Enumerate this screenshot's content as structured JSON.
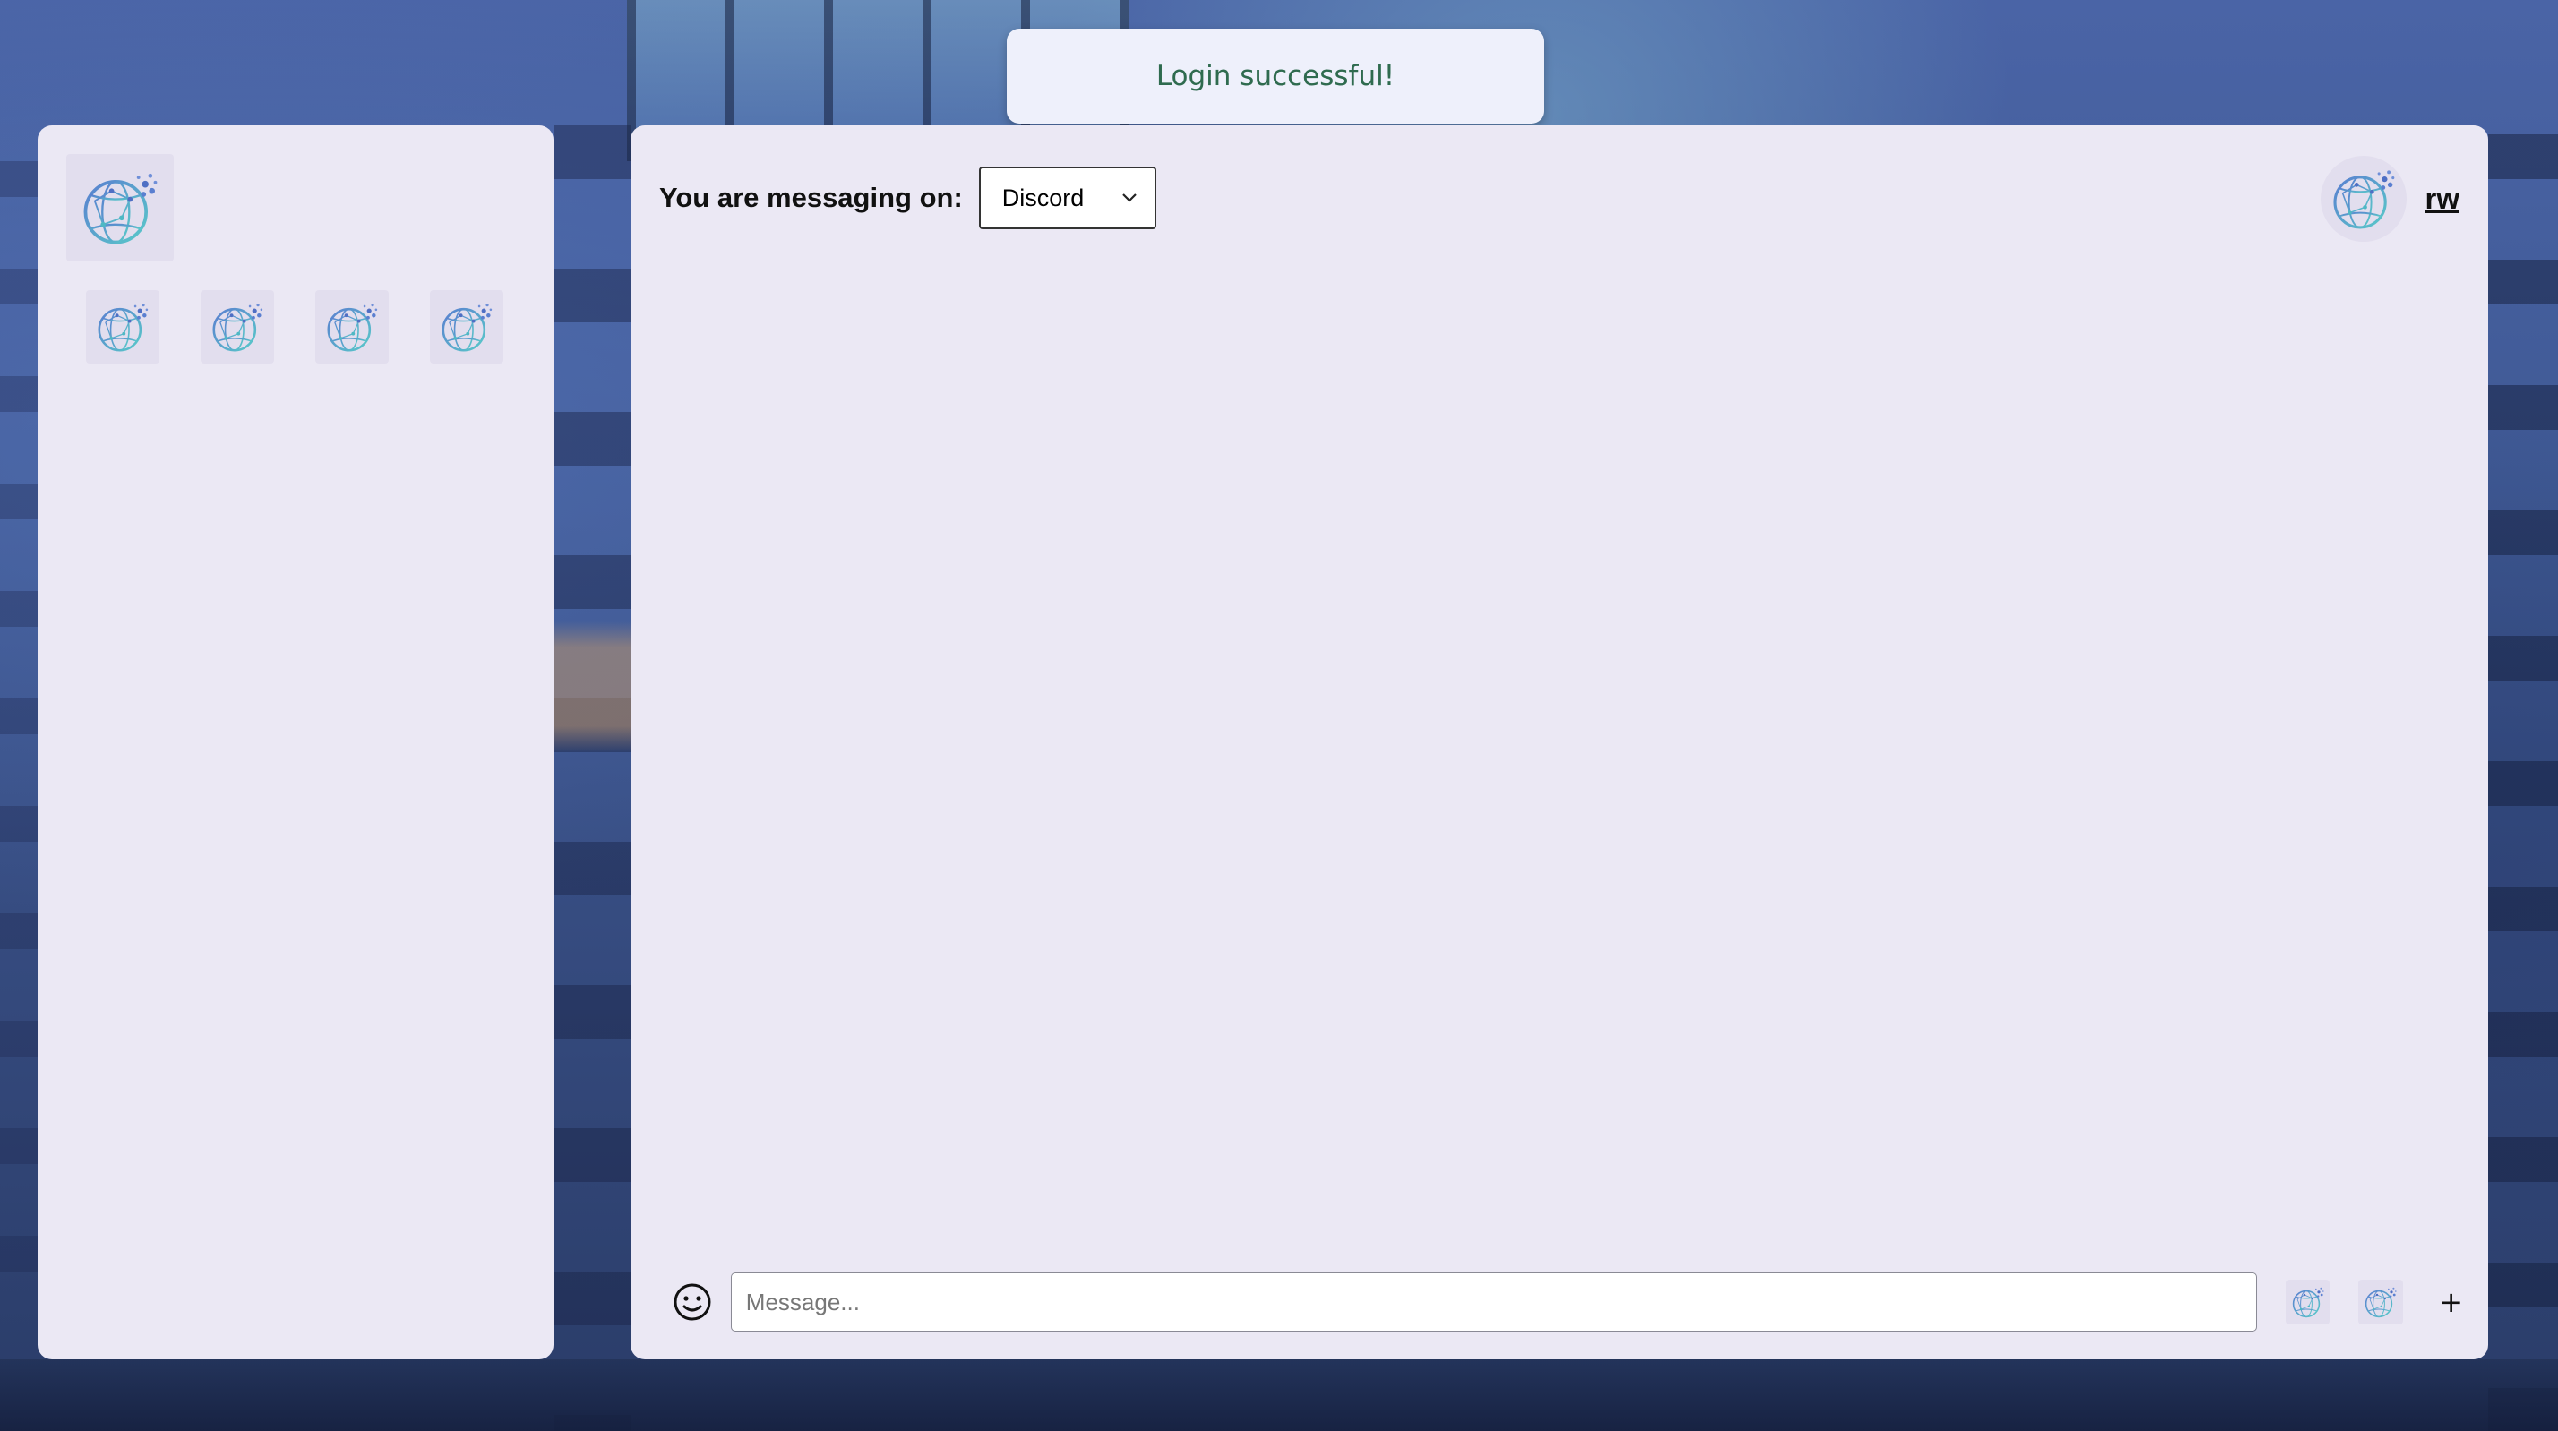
{
  "toast": {
    "message": "Login successful!"
  },
  "sidebar": {
    "app_logo": "globe-network-logo",
    "servers": [
      {
        "icon": "globe-network-logo"
      },
      {
        "icon": "globe-network-logo"
      },
      {
        "icon": "globe-network-logo"
      },
      {
        "icon": "globe-network-logo"
      }
    ]
  },
  "header": {
    "messaging_label": "You are messaging on:",
    "platform_select": {
      "selected": "Discord"
    }
  },
  "user": {
    "name": "rw",
    "avatar": "globe-network-logo"
  },
  "composer": {
    "placeholder": "Message...",
    "value": "",
    "emoji_icon": "smiley-icon",
    "add_label": "+"
  },
  "colors": {
    "panel_bg": "#ebe8f4",
    "toast_bg": "#eef0fb",
    "toast_text": "#2f6b4f",
    "page_bg": "#3f5994"
  }
}
